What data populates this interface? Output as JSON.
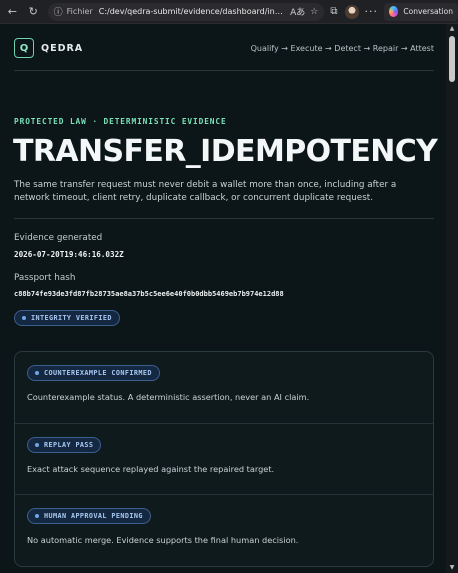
{
  "browser": {
    "info_label": "Fichier",
    "url": "C:/dev/qedra-submit/evidence/dashboard/index...",
    "conversation_label": "Conversation"
  },
  "header": {
    "logo_letter": "Q",
    "brand": "QEDRA",
    "flow": "Qualify → Execute → Detect → Repair → Attest"
  },
  "hero": {
    "eyebrow": "PROTECTED LAW · DETERMINISTIC EVIDENCE",
    "title": "TRANSFER_IDEMPOTENCY",
    "description": "The same transfer request must never debit a wallet more than once, including after a network timeout, client retry, duplicate callback, or concurrent duplicate request."
  },
  "evidence": {
    "generated_label": "Evidence generated",
    "generated_value": "2026-07-20T19:46:16.032Z",
    "hash_label": "Passport hash",
    "hash_value": "c88b74fe93de3fd87fb28735ae8a37b5c5ee6e40f0b0dbb5469eb7b974e12d88",
    "integrity_badge": "INTEGRITY VERIFIED"
  },
  "statuses": [
    {
      "badge": "COUNTEREXAMPLE CONFIRMED",
      "text": "Counterexample status. A deterministic assertion, never an AI claim."
    },
    {
      "badge": "REPLAY PASS",
      "text": "Exact attack sequence replayed against the repaired target."
    },
    {
      "badge": "HUMAN APPROVAL PENDING",
      "text": "No automatic merge. Evidence supports the final human decision."
    }
  ],
  "colors": {
    "accent": "#7be0b8",
    "badge_blue": "#a9c8f0",
    "background": "#0c1517"
  }
}
